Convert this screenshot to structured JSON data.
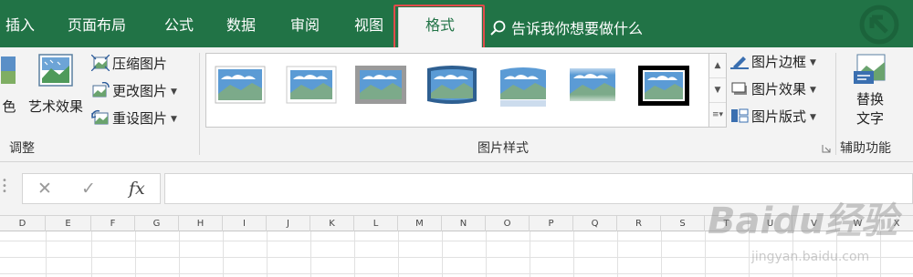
{
  "tabs": [
    {
      "id": "insert",
      "label": "插入"
    },
    {
      "id": "page_layout",
      "label": "页面布局"
    },
    {
      "id": "formulas",
      "label": "公式"
    },
    {
      "id": "data",
      "label": "数据"
    },
    {
      "id": "review",
      "label": "审阅"
    },
    {
      "id": "view",
      "label": "视图"
    },
    {
      "id": "format",
      "label": "格式",
      "active": true
    }
  ],
  "tell_me": {
    "text": "告诉我你想要做什么",
    "icon": "search-icon"
  },
  "ribbon": {
    "adjust": {
      "color_label": "色",
      "artistic_effects_label": "艺术效果",
      "compress_label": "压缩图片",
      "change_label": "更改图片",
      "reset_label": "重设图片",
      "group_label": "调整"
    },
    "picture_styles": {
      "group_label": "图片样式",
      "thumbnails": [
        "style-1",
        "style-2",
        "style-3",
        "style-4",
        "style-5",
        "style-6",
        "style-7"
      ],
      "border_label": "图片边框",
      "effects_label": "图片效果",
      "layout_label": "图片版式"
    },
    "accessibility": {
      "alt_text_line1": "替换",
      "alt_text_line2": "文字",
      "group_label": "辅助功能"
    }
  },
  "formula_bar": {
    "cancel_symbol": "✕",
    "enter_symbol": "✓",
    "fx_symbol": "fx",
    "value": ""
  },
  "columns": [
    "D",
    "E",
    "F",
    "G",
    "H",
    "I",
    "J",
    "K",
    "L",
    "M",
    "N",
    "O",
    "P",
    "Q",
    "R",
    "S",
    "T",
    "U",
    "V",
    "W",
    "X"
  ],
  "watermark": {
    "main": "Baidu经验",
    "sub": "jingyan.baidu.com"
  },
  "colors": {
    "accent": "#217346",
    "highlight": "#e24a4a",
    "ribbon_bg": "#f3f3f3"
  }
}
